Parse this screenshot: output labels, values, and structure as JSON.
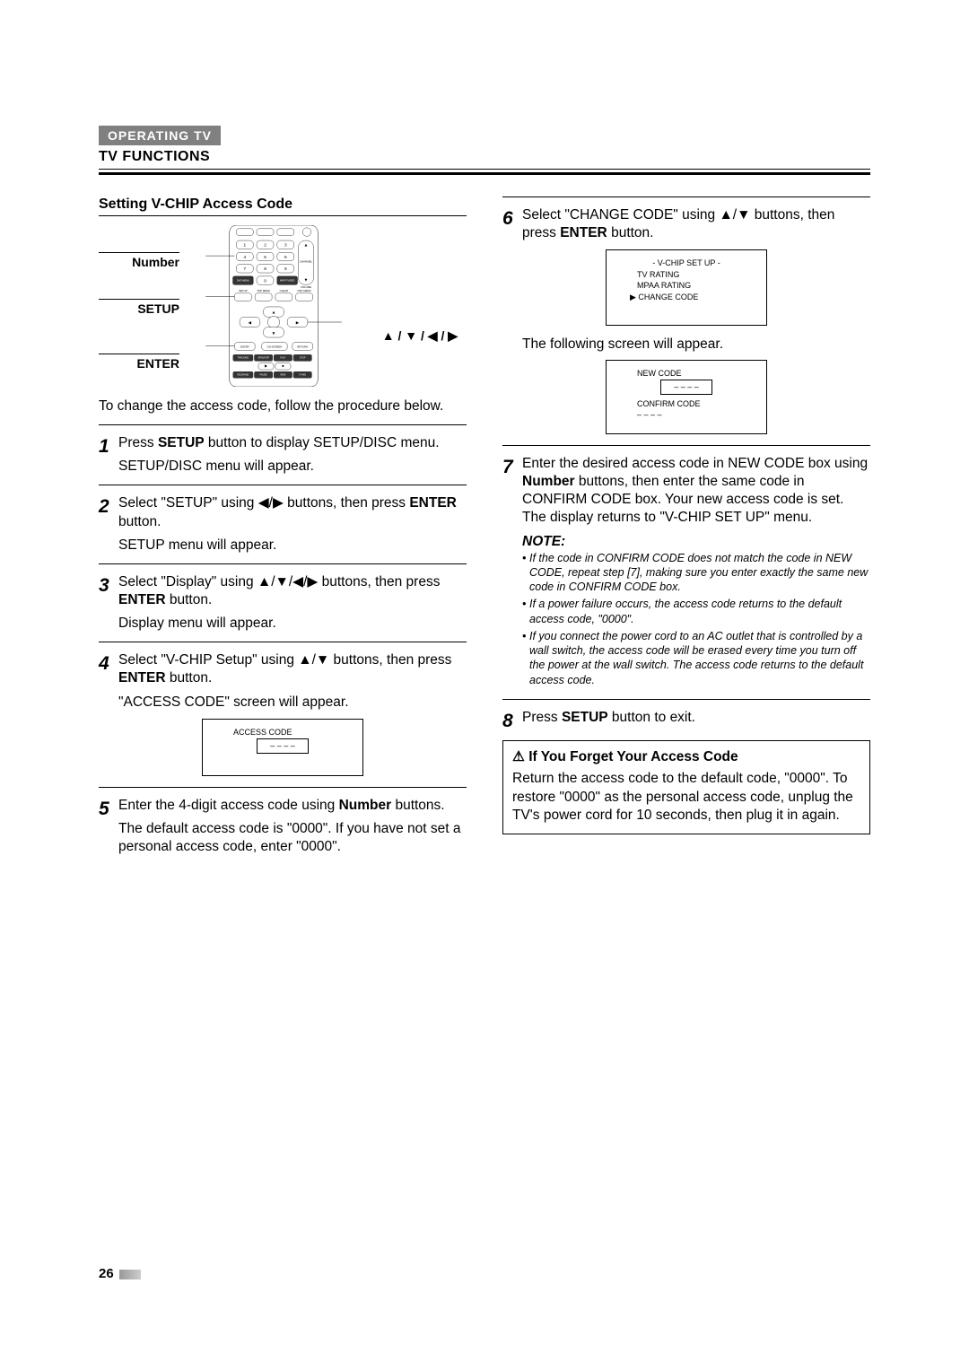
{
  "chapter_tag": "OPERATING TV",
  "section_title": "TV FUNCTIONS",
  "sub_title": "Setting V-CHIP Access Code",
  "remote_labels": {
    "number": "Number",
    "setup": "SETUP",
    "enter": "ENTER"
  },
  "remote_buttons": {
    "btn1": "1",
    "btn2": "2",
    "btn3": "3",
    "btn4": "4",
    "btn5": "5",
    "btn6": "6",
    "btn7": "7",
    "btn8": "8",
    "btn9": "9",
    "btn0": "0",
    "channel": "CHANNEL",
    "volume": "VOLUME",
    "dvd_menu": "DVD MENU",
    "input_video": "INPUT/VIDEO",
    "setup": "SETUP",
    "top_menu": "TOP MENU",
    "clear": "CLEAR",
    "osc_menu": "OSC MENU",
    "enter": "ENTER",
    "on_screen": "ON SCREEN",
    "return": "RETURN",
    "tracking": "TRACKING",
    "sp_slp_ep": "SP/SLP EP",
    "play": "PLAY",
    "stop": "STOP",
    "rec_rand": "REC/RAND",
    "pause": "PAUSE",
    "rew": "REW",
    "f_fwd": "F.FWD",
    "skip": "SKIP"
  },
  "nav_symbol": "▲ / ▼ / ◀ / ▶",
  "intro": "To change the access code, follow the procedure below.",
  "steps_left": [
    {
      "num": "1",
      "text_parts": [
        "Press ",
        "SETUP",
        " button to display SETUP/DISC menu."
      ],
      "bold_idx": [
        1
      ],
      "sub": "SETUP/DISC menu will appear."
    },
    {
      "num": "2",
      "text_parts": [
        "Select \"SETUP\" using ◀/▶ buttons, then press ",
        "ENTER",
        " button."
      ],
      "bold_idx": [
        1
      ],
      "sub": "SETUP menu will appear."
    },
    {
      "num": "3",
      "text_parts": [
        "Select \"Display\" using ▲/▼/◀/▶ buttons, then press ",
        "ENTER",
        " button."
      ],
      "bold_idx": [
        1
      ],
      "sub": "Display menu will appear."
    },
    {
      "num": "4",
      "text_parts": [
        "Select \"V-CHIP Setup\" using ▲/▼ buttons, then press ",
        "ENTER",
        " button."
      ],
      "bold_idx": [
        1
      ],
      "sub": "\"ACCESS CODE\" screen will appear."
    }
  ],
  "osd_access": {
    "title": "ACCESS CODE",
    "fields": [
      "– – – –"
    ]
  },
  "step5": {
    "num": "5",
    "text_parts": [
      "Enter the 4-digit access code using ",
      "Number",
      " buttons."
    ],
    "bold_idx": [
      1
    ],
    "sub": "The default access code is \"0000\". If you have not set a personal access code, enter \"0000\"."
  },
  "step6": {
    "num": "6",
    "text_parts": [
      "Select \"CHANGE CODE\" using ▲/▼ buttons, then press ",
      "ENTER",
      " button."
    ],
    "bold_idx": [
      1
    ]
  },
  "osd_vchip": {
    "title": "- V-CHIP SET UP -",
    "items": [
      "TV RATING",
      "MPAA RATING",
      "▶ CHANGE CODE"
    ]
  },
  "following_text": "The following screen will appear.",
  "osd_newcode": {
    "line1": "NEW CODE",
    "field1": "– – – –",
    "line2": "CONFIRM CODE",
    "field2": "– – – –"
  },
  "step7": {
    "num": "7",
    "text_parts": [
      "Enter the desired access code in NEW CODE box using ",
      "Number",
      " buttons, then enter the same code in CONFIRM CODE box. Your new access code is set. The display returns to \"V-CHIP SET UP\" menu."
    ],
    "bold_idx": [
      1
    ]
  },
  "note_title": "NOTE:",
  "notes": [
    "If the code in CONFIRM CODE does not match the code in NEW CODE, repeat step [7], making sure you enter exactly the same new code in CONFIRM CODE box.",
    "If a power failure occurs, the access code returns to the default access code, \"0000\".",
    "If you connect the power cord to an AC outlet that is controlled by a wall switch, the access code will be erased every time you turn off the power at the wall switch. The access code returns to the default access code."
  ],
  "step8": {
    "num": "8",
    "text_parts": [
      "Press ",
      "SETUP",
      " button to exit."
    ],
    "bold_idx": [
      1
    ]
  },
  "forget": {
    "title": "If You Forget Your Access Code",
    "warning_icon": "⚠",
    "body": "Return the access code to the default code, \"0000\". To restore \"0000\" as the personal access code, unplug the TV's power cord for 10 seconds, then plug it in again."
  },
  "page_number": "26"
}
